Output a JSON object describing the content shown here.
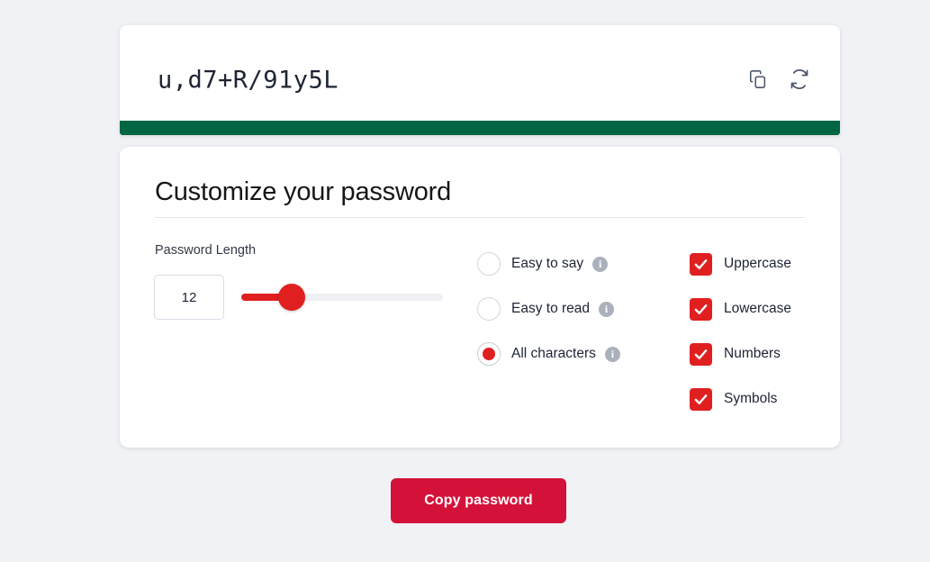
{
  "password_display": {
    "value": "u,d7+R/91y5L",
    "copy_icon": "copy-icon",
    "refresh_icon": "refresh-icon",
    "strength_color": "#006644",
    "strength_percent": 100
  },
  "customize": {
    "title": "Customize your password",
    "length": {
      "label": "Password Length",
      "value": "12",
      "slider_percent": 25,
      "accent_color": "#e02020"
    },
    "character_modes": [
      {
        "label": "Easy to say",
        "selected": false,
        "info_icon": "info-icon"
      },
      {
        "label": "Easy to read",
        "selected": false,
        "info_icon": "info-icon"
      },
      {
        "label": "All characters",
        "selected": true,
        "info_icon": "info-icon"
      }
    ],
    "character_sets": [
      {
        "label": "Uppercase",
        "checked": true
      },
      {
        "label": "Lowercase",
        "checked": true
      },
      {
        "label": "Numbers",
        "checked": true
      },
      {
        "label": "Symbols",
        "checked": true
      }
    ]
  },
  "actions": {
    "copy_password_label": "Copy password",
    "copy_button_color": "#d41239"
  }
}
